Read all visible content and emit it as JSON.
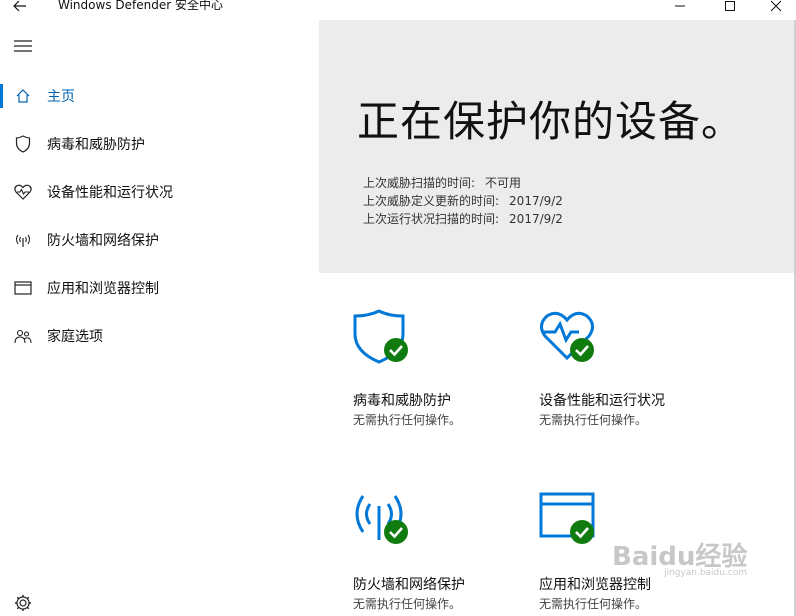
{
  "window": {
    "title": "Windows Defender 安全中心",
    "back_icon": "back-arrow-icon",
    "minimize_icon": "minimize-icon",
    "maximize_icon": "maximize-icon",
    "close_icon": "close-icon"
  },
  "sidebar": {
    "menu_icon": "hamburger-icon",
    "items": [
      {
        "label": "主页",
        "icon": "home-icon",
        "active": true
      },
      {
        "label": "病毒和威胁防护",
        "icon": "shield-icon",
        "active": false
      },
      {
        "label": "设备性能和运行状况",
        "icon": "heart-pulse-icon",
        "active": false
      },
      {
        "label": "防火墙和网络保护",
        "icon": "wireless-antenna-icon",
        "active": false
      },
      {
        "label": "应用和浏览器控制",
        "icon": "browser-window-icon",
        "active": false
      },
      {
        "label": "家庭选项",
        "icon": "family-icon",
        "active": false
      }
    ],
    "settings_icon": "gear-icon"
  },
  "hero": {
    "title": "正在保护你的设备。",
    "scans": [
      {
        "key": "上次威胁扫描的时间:",
        "value": "不可用"
      },
      {
        "key": "上次威胁定义更新的时间:",
        "value": "2017/9/2"
      },
      {
        "key": "上次运行状况扫描的时间:",
        "value": "2017/9/2"
      }
    ]
  },
  "tiles": [
    {
      "title": "病毒和威胁防护",
      "subtitle": "无需执行任何操作。",
      "icon": "shield-check-icon"
    },
    {
      "title": "设备性能和运行状况",
      "subtitle": "无需执行任何操作。",
      "icon": "heart-pulse-check-icon"
    },
    {
      "title": "防火墙和网络保护",
      "subtitle": "无需执行任何操作。",
      "icon": "antenna-check-icon"
    },
    {
      "title": "应用和浏览器控制",
      "subtitle": "无需执行任何操作。",
      "icon": "browser-check-icon"
    }
  ],
  "watermark": {
    "text": "Baidu经验",
    "url": "jingyan.baidu.com"
  },
  "colors": {
    "accent": "#0078d7",
    "ok_green": "#107c10",
    "hero_bg": "#ececec"
  }
}
